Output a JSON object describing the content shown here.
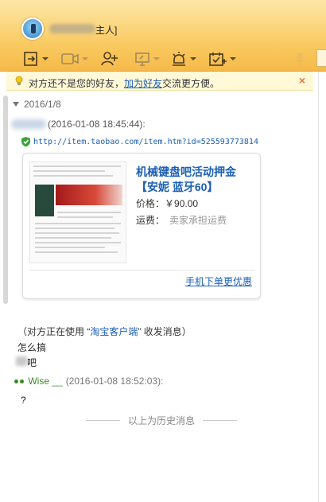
{
  "title_bar": {
    "title_suffix": "主人]"
  },
  "toolbar": {
    "icons": [
      "send-file-icon",
      "video-call-icon",
      "add-contact-icon",
      "screen-share-icon",
      "alarm-icon",
      "task-icon"
    ]
  },
  "notice": {
    "text_before": "对方还不是您的好友，",
    "link": "加为好友",
    "text_after": "交流更方便。",
    "close": "×"
  },
  "chat": {
    "date": "2016/1/8",
    "msg1_meta": "(2016-01-08 18:45:44):",
    "url": "http://item.taobao.com/item.htm?id=525593773814",
    "card": {
      "title": "机械键盘吧活动押金【安妮 蓝牙60】",
      "price_label": "价格：",
      "price_value": "￥90.00",
      "shipping_label": "运费：",
      "shipping_value": "卖家承担运费",
      "mobile_link": "手机下单更优惠"
    },
    "sys_before": "（对方正在使用 “",
    "sys_link": "淘宝客户端",
    "sys_after": "” 收发消息）",
    "line1": "怎么搞",
    "line2": "吧",
    "sender2_name": "Wise __",
    "sender2_meta": "(2016-01-08 18:52:03):",
    "line3": "?",
    "history_divider": "以上为历史消息"
  },
  "colors": {
    "toolbar": "#f9c95f",
    "link": "#1a5fb4",
    "sender_green": "#3a8a24",
    "notice_bg": "#fff9d8"
  }
}
